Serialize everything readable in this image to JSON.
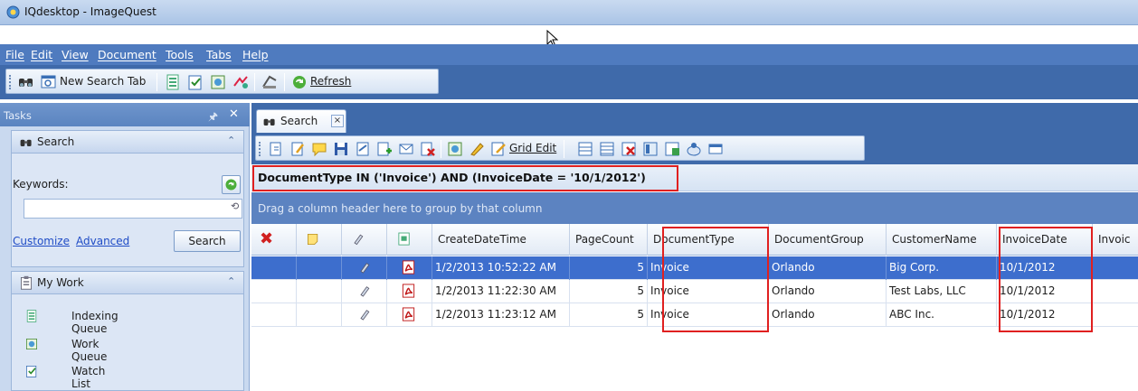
{
  "window": {
    "title": "IQdesktop - ImageQuest"
  },
  "menu": [
    "File",
    "Edit",
    "View",
    "Document",
    "Tools",
    "Tabs",
    "Help"
  ],
  "toolbar": {
    "new_search_tab": "New Search Tab",
    "refresh": "Refresh"
  },
  "tasks": {
    "header": "Tasks",
    "search_panel": {
      "title": "Search",
      "keywords_label": "Keywords:",
      "keywords_value": "",
      "customize": "Customize",
      "advanced": "Advanced",
      "search_button": "Search"
    },
    "my_work": {
      "title": "My Work",
      "items": [
        {
          "label": "Indexing Queue",
          "icon": "indexing-queue-icon"
        },
        {
          "label": "Work Queue",
          "icon": "work-queue-icon"
        },
        {
          "label": "Watch List",
          "icon": "watch-list-icon"
        }
      ]
    }
  },
  "search_tab": {
    "label": "Search",
    "close": "×"
  },
  "grid_toolbar": {
    "grid_edit": "Grid Edit"
  },
  "filter": "DocumentType IN ('Invoice') AND (InvoiceDate = '10/1/2012')",
  "group_hint": "Drag a column header here to group by that column",
  "grid": {
    "columns": [
      "",
      "",
      "",
      "",
      "CreateDateTime",
      "PageCount",
      "DocumentType",
      "DocumentGroup",
      "CustomerName",
      "InvoiceDate",
      "Invoic"
    ],
    "rows": [
      {
        "CreateDateTime": "1/2/2013 10:52:22 AM",
        "PageCount": "5",
        "DocumentType": "Invoice",
        "DocumentGroup": "Orlando",
        "CustomerName": "Big Corp.",
        "InvoiceDate": "10/1/2012",
        "selected": true
      },
      {
        "CreateDateTime": "1/2/2013 11:22:30 AM",
        "PageCount": "5",
        "DocumentType": "Invoice",
        "DocumentGroup": "Orlando",
        "CustomerName": "Test Labs, LLC",
        "InvoiceDate": "10/1/2012",
        "selected": false
      },
      {
        "CreateDateTime": "1/2/2013 11:23:12 AM",
        "PageCount": "5",
        "DocumentType": "Invoice",
        "DocumentGroup": "Orlando",
        "CustomerName": "ABC Inc.",
        "InvoiceDate": "10/1/2012",
        "selected": false
      }
    ]
  },
  "colors": {
    "accent_blue": "#3f6aaa",
    "selection": "#3d6ecd",
    "highlight_red": "#e02020"
  }
}
